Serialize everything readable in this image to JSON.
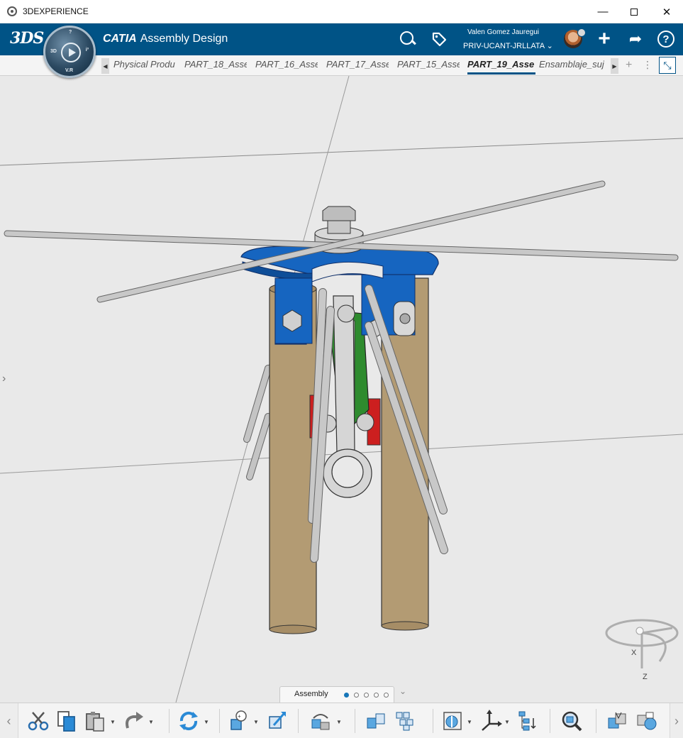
{
  "window": {
    "title": "3DEXPERIENCE",
    "controls": {
      "minimize": "—",
      "maximize": "",
      "close": "✕"
    }
  },
  "header": {
    "brand": "CATIA",
    "app_name": "Assembly Design",
    "compass": {
      "top": "?",
      "left": "3D",
      "right": "i³",
      "bottom": "V.R"
    },
    "user_name": "Valen Gomez Jauregui",
    "tenant": "PRIV-UCANT-JRLLATA",
    "tenant_chevron": "⌄",
    "icons": [
      "search-icon",
      "tag-icon",
      "plus-icon",
      "share-icon",
      "help-icon"
    ],
    "plus_glyph": "+",
    "share_glyph": "➦",
    "help_glyph": "?"
  },
  "tabs": {
    "items": [
      {
        "label": "Physical Produ",
        "active": false
      },
      {
        "label": "PART_18_Asse",
        "active": false
      },
      {
        "label": "PART_16_Asse",
        "active": false
      },
      {
        "label": "PART_17_Asse",
        "active": false
      },
      {
        "label": "PART_15_Asse",
        "active": false
      },
      {
        "label": "PART_19_Asse",
        "active": true
      },
      {
        "label": "Ensamblaje_suj",
        "active": false
      }
    ],
    "scroll_left": "◀",
    "scroll_right": "▶",
    "add": "+",
    "menu": "⋮",
    "collapse_glyph": "⤡"
  },
  "viewport": {
    "background": "#e9e9e9",
    "side_arrow": "›",
    "compass_axes": {
      "x": "X",
      "z": "Z"
    },
    "colors": {
      "rod": "#c4c4c4",
      "tube": "#b39b73",
      "plate": "#1665c0",
      "link": "#2e8b2e",
      "pad": "#cc1f1f"
    }
  },
  "action_bar": {
    "section_name": "Assembly",
    "section_count": 5,
    "section_active_index": 0,
    "expand_glyph": "⌄",
    "scroll_left": "‹",
    "scroll_right": "›",
    "tools": [
      "cut-icon",
      "copy-icon",
      "paste-icon",
      "redo-icon",
      "update-icon",
      "insert-component-icon",
      "move-component-icon",
      "engineering-connection-icon",
      "explode-icon",
      "pattern-icon",
      "section-icon",
      "robot-icon",
      "tree-reorder-icon",
      "search-in-3d-icon",
      "clash-icon",
      "compare-icon"
    ]
  }
}
